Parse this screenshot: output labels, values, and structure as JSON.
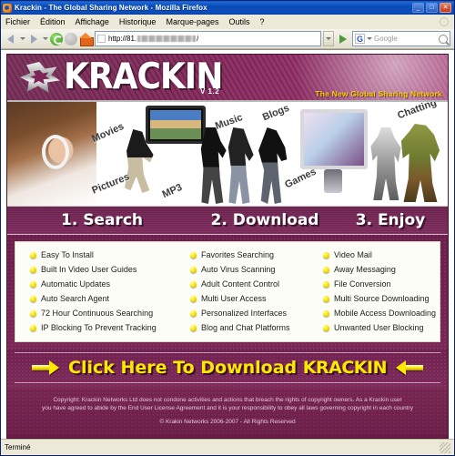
{
  "browser": {
    "title": "Krackin - The Global Sharing Network - Mozilla Firefox",
    "window_buttons": {
      "minimize": "_",
      "maximize": "□",
      "close": "✕"
    },
    "menus": [
      "Fichier",
      "Édition",
      "Affichage",
      "Historique",
      "Marque-pages",
      "Outils",
      "?"
    ],
    "address": {
      "prefix": "http://81.",
      "suffix": "/",
      "placeholder": ""
    },
    "search": {
      "placeholder": "Google",
      "engine_letter": "G"
    },
    "status": "Terminé"
  },
  "site": {
    "header": {
      "logo_text": "KRACKIN",
      "version": "V 1.2",
      "tagline": "The New Global Sharing Network"
    },
    "hero": {
      "labels": [
        "Movies",
        "Pictures",
        "MP3",
        "Music",
        "Blogs",
        "Games",
        "Chatting"
      ]
    },
    "steps": [
      "1. Search",
      "2. Download",
      "3. Enjoy"
    ],
    "features": {
      "column1": [
        "Easy To Install",
        "Built In Video User Guides",
        "Automatic Updates",
        "Auto Search Agent",
        "72 Hour Continuous Searching",
        "IP Blocking To Prevent Tracking"
      ],
      "column2": [
        "Favorites Searching",
        "Auto Virus Scanning",
        "Adult Content Control",
        "Multi User Access",
        "Personalized Interfaces",
        "Blog and Chat Platforms"
      ],
      "column3": [
        "Video Mail",
        "Away Messaging",
        "File Conversion",
        "Multi Source Downloading",
        "Mobile Access Downloading",
        "Unwanted User Blocking"
      ]
    },
    "cta": {
      "text": "Click Here To Download ",
      "brand": "KRACKIN"
    },
    "footer": {
      "line1": "Copyright: Krackin Networks Ltd does not condone activities and actions that breach the rights of copyright owners. As a Krackin user",
      "line2": "you have agreed to abide by the End User License Agreement and it is your responsibility to obey all laws governing copyright in each country",
      "copyright": "© Krakin Networks 2006-2007 - All Rights Reserved"
    }
  },
  "colors": {
    "brand_purple": "#6b1f4b",
    "brand_magenta": "#8a2a60",
    "accent_yellow": "#ffe800",
    "bullet_yellow": "#ffe600",
    "titlebar_blue": "#0a4ab4"
  }
}
